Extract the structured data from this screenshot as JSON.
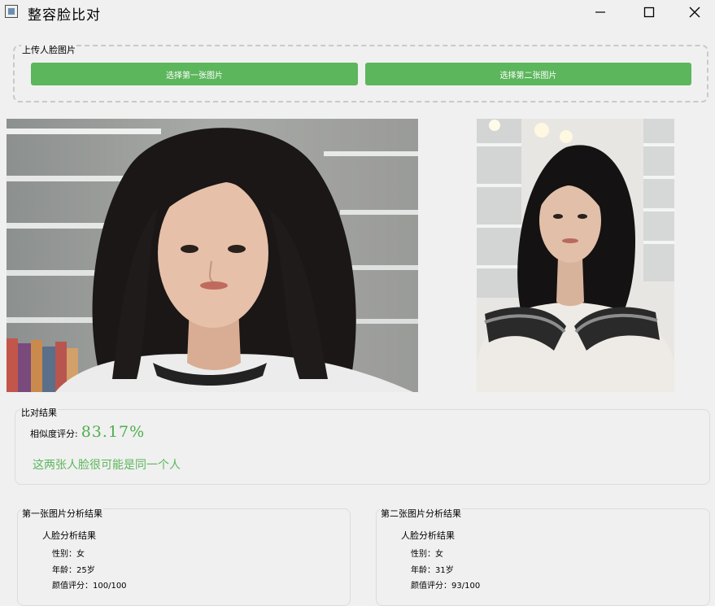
{
  "window": {
    "title": "整容脸比对"
  },
  "upload": {
    "group_label": "上传人脸图片",
    "button1_label": "选择第一张图片",
    "button2_label": "选择第二张图片"
  },
  "images": [
    {
      "description": "photo 1"
    },
    {
      "description": "photo 2"
    }
  ],
  "result": {
    "group_label": "比对结果",
    "similarity_label": "相似度评分:",
    "similarity_value": "83.17%",
    "verdict": "这两张人脸很可能是同一个人",
    "verdict_color": "#5cb65c",
    "button_color": "#5cb65c"
  },
  "analysis": [
    {
      "title": "第一张图片分析结果",
      "heading": "人脸分析结果",
      "gender_label": "性别",
      "gender": "女",
      "age_label": "年龄",
      "age": "25岁",
      "beauty_label": "颜值评分",
      "beauty": "100/100"
    },
    {
      "title": "第二张图片分析结果",
      "heading": "人脸分析结果",
      "gender_label": "性别",
      "gender": "女",
      "age_label": "年龄",
      "age": "31岁",
      "beauty_label": "颜值评分",
      "beauty": "93/100"
    }
  ]
}
